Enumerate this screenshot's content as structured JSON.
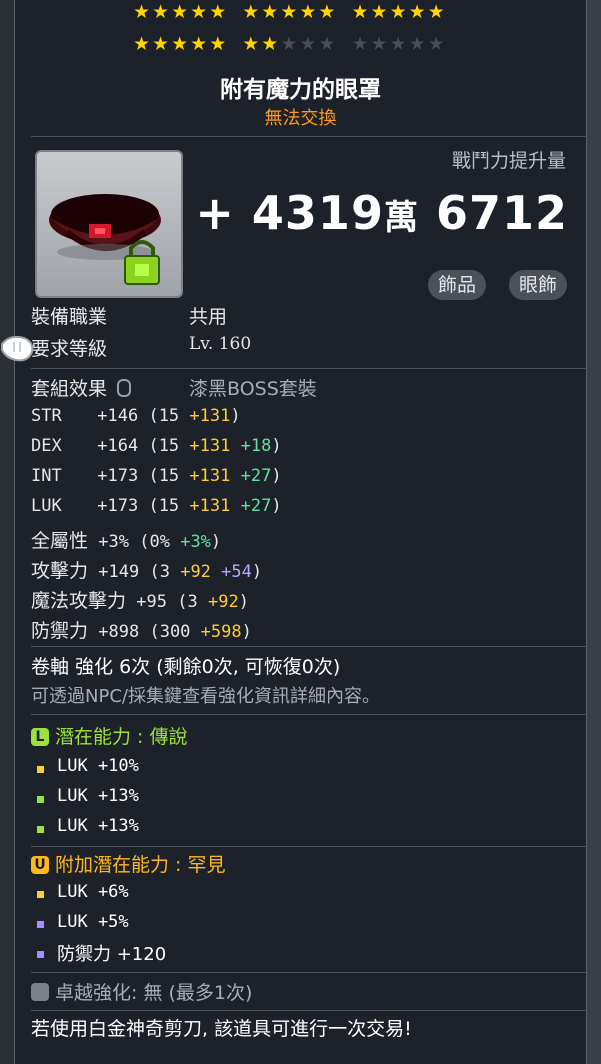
{
  "stars": {
    "row1": [
      5,
      5,
      5
    ],
    "row2_filled": 7,
    "row2_total": 15
  },
  "item": {
    "name": "附有魔力的眼罩",
    "trade": "無法交換"
  },
  "combat": {
    "label": "戰鬥力提升量",
    "sign": "+",
    "big": "4319",
    "unit": "萬",
    "small": "6712"
  },
  "tags": [
    "飾品",
    "眼飾"
  ],
  "requirements": {
    "job_label": "裝備職業",
    "job_value": "共用",
    "level_label": "要求等級",
    "level_value": "Lv. 160"
  },
  "set": {
    "label": "套組效果",
    "value": "漆黑BOSS套裝"
  },
  "stats": [
    {
      "name": "STR",
      "total": "+146",
      "base": "(15",
      "add": "+131",
      "bonus": "",
      "end": ")"
    },
    {
      "name": "DEX",
      "total": "+164",
      "base": "(15",
      "add": "+131",
      "bonus": "+18",
      "end": ")"
    },
    {
      "name": "INT",
      "total": "+173",
      "base": "(15",
      "add": "+131",
      "bonus": "+27",
      "end": ")"
    },
    {
      "name": "LUK",
      "total": "+173",
      "base": "(15",
      "add": "+131",
      "bonus": "+27",
      "end": ")"
    }
  ],
  "all_stat": {
    "name": "全屬性",
    "total": "+3%",
    "base": "(0%",
    "bonus": "+3%",
    "end": ")"
  },
  "attack": {
    "name": "攻擊力",
    "total": "+149",
    "base": "(3",
    "add": "+92",
    "bonus": "+54",
    "end": ")"
  },
  "magic": {
    "name": "魔法攻擊力",
    "total": "+95",
    "base": "(3",
    "add": "+92",
    "end": ")"
  },
  "defense": {
    "name": "防禦力",
    "total": "+898",
    "base": "(300",
    "add": "+598",
    "end": ")"
  },
  "scroll": {
    "line": "卷軸 強化 6次 (剩餘0次, 可恢復0次)",
    "hint": "可透過NPC/採集鍵查看強化資訊詳細內容。"
  },
  "potential": {
    "badge": "L",
    "title": "潛在能力 : 傳說",
    "lines": [
      "LUK +10%",
      "LUK +13%",
      "LUK +13%"
    ]
  },
  "additional": {
    "badge": "U",
    "title": "附加潛在能力 : 罕見",
    "lines": [
      "LUK +6%",
      "LUK +5%",
      "防禦力 +120"
    ]
  },
  "exceptional": {
    "text": "卓越強化: 無 (最多1次)"
  },
  "footer": "若使用白金神奇剪刀, 該道具可進行一次交易!",
  "colors": {
    "legendary": "#9be33b",
    "unique": "#ffb81e",
    "rare_bullet": "#a78bff"
  }
}
